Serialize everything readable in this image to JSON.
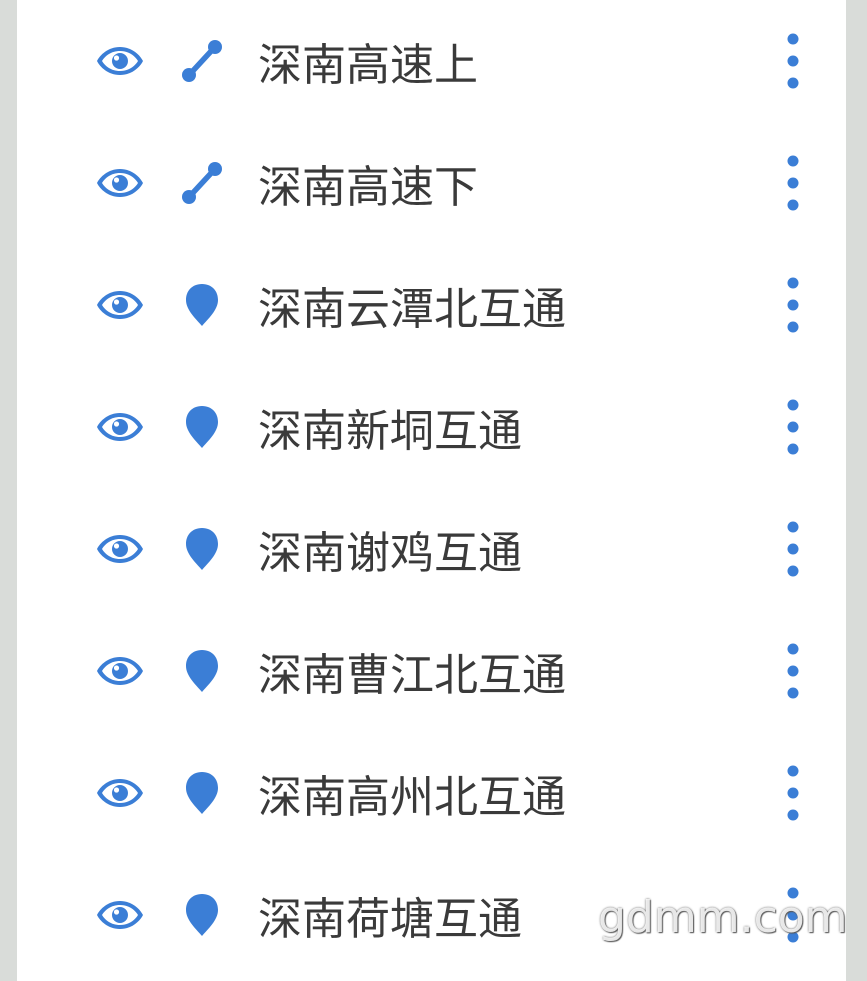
{
  "accent_color": "#3b7ed6",
  "icons": {
    "visibility": "eye-icon",
    "route": "route-icon",
    "place": "map-pin-icon",
    "menu": "more-vertical-icon"
  },
  "layers": [
    {
      "label": "深南高速上",
      "type": "route"
    },
    {
      "label": "深南高速下",
      "type": "route"
    },
    {
      "label": "深南云潭北互通",
      "type": "place"
    },
    {
      "label": "深南新垌互通",
      "type": "place"
    },
    {
      "label": "深南谢鸡互通",
      "type": "place"
    },
    {
      "label": "深南曹江北互通",
      "type": "place"
    },
    {
      "label": "深南高州北互通",
      "type": "place"
    },
    {
      "label": "深南荷塘互通",
      "type": "place"
    }
  ],
  "watermark": "gdmm.com"
}
